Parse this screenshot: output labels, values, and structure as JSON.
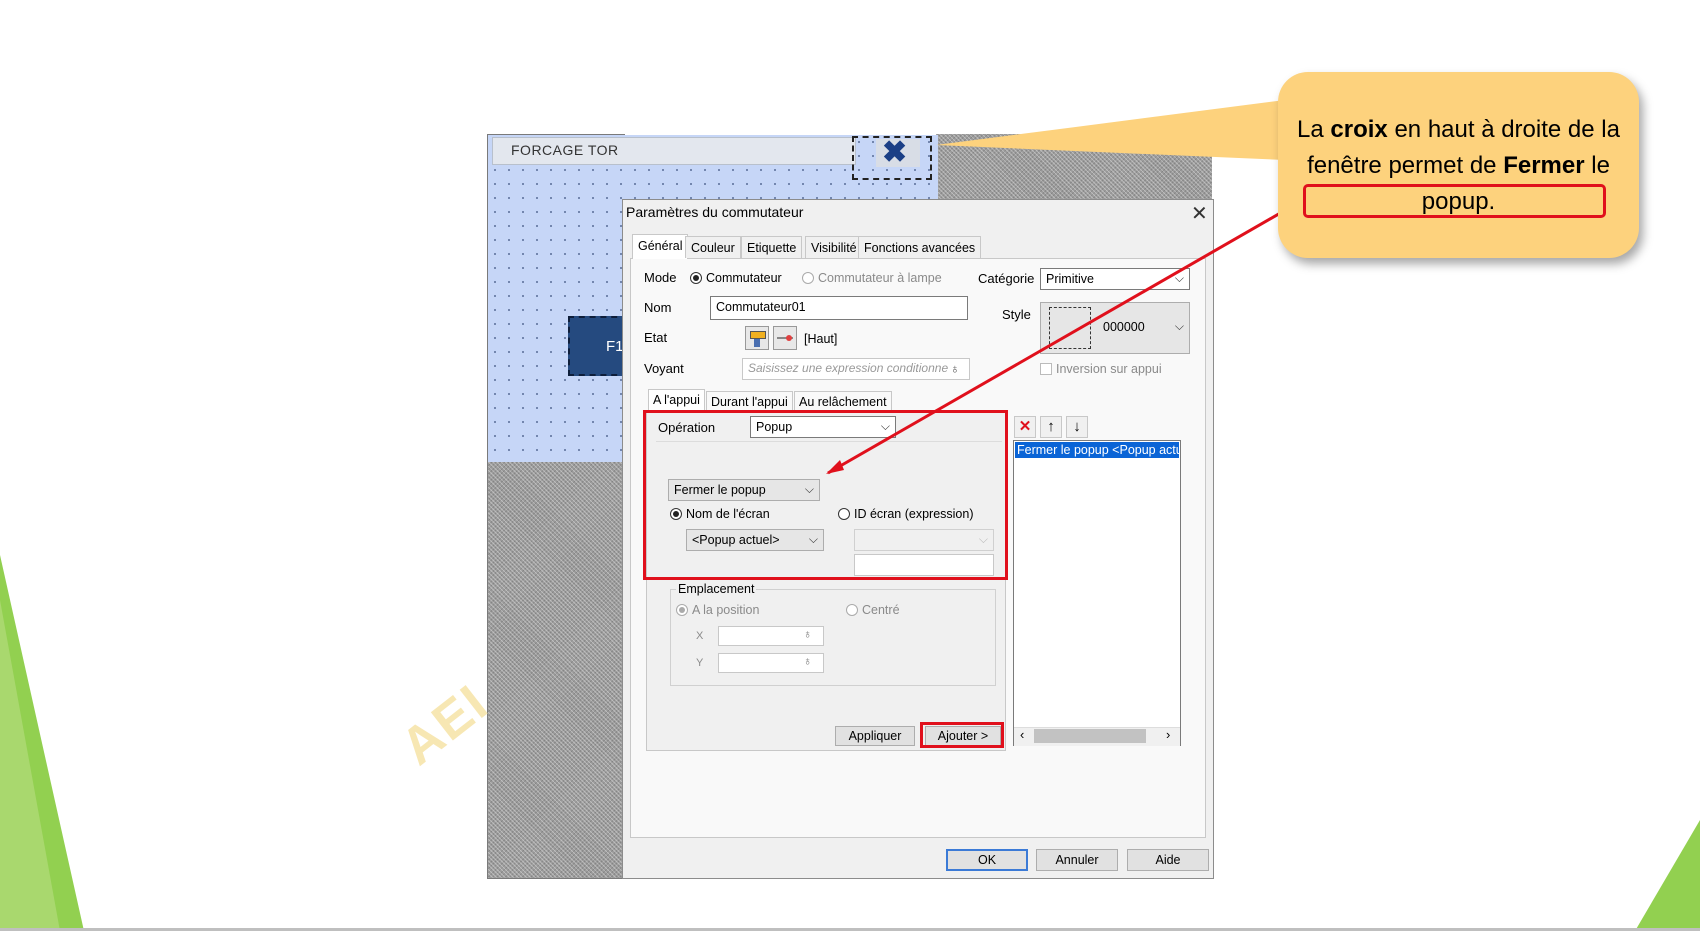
{
  "popup": {
    "title": "FORCAGE  TOR",
    "close_glyph": "✖",
    "button_label": "F1"
  },
  "watermark": "AEI",
  "dialog": {
    "title": "Paramètres du commutateur",
    "close_glyph": "✕",
    "tabs": [
      "Général",
      "Couleur",
      "Etiquette",
      "Visibilité",
      "Fonctions avancées"
    ],
    "mode_label": "Mode",
    "mode_option_1": "Commutateur",
    "mode_option_2": "Commutateur à lampe",
    "categorie_label": "Catégorie",
    "categorie_value": "Primitive",
    "nom_label": "Nom",
    "nom_value": "Commutateur01",
    "style_label": "Style",
    "style_value": "000000",
    "etat_label": "Etat",
    "etat_value": "[Haut]",
    "voyant_label": "Voyant",
    "voyant_placeholder": "Saisissez une expression conditionne",
    "inversion_label": "Inversion sur appui",
    "subtabs": [
      "A l'appui",
      "Durant l'appui",
      "Au relâchement"
    ],
    "operation_label": "Opération",
    "operation_value": "Popup",
    "action_value": "Fermer le popup",
    "nom_ecran_label": "Nom de l'écran",
    "id_ecran_label": "ID écran (expression)",
    "screen_value": "<Popup actuel>",
    "emplacement_label": "Emplacement",
    "a_la_position_label": "A la position",
    "centre_label": "Centré",
    "x_label": "X",
    "y_label": "Y",
    "list_item": "Fermer le popup <Popup actuel>",
    "appliquer_label": "Appliquer",
    "ajouter_label": "Ajouter >",
    "ok_label": "OK",
    "annuler_label": "Annuler",
    "aide_label": "Aide"
  },
  "callout": {
    "part1": "La ",
    "bold1": "croix",
    "part2": " en haut à droite de la fenêtre permet de ",
    "bold2": "Fermer",
    "part3": " le popup."
  },
  "colors": {
    "highlight_red": "#e0101c",
    "callout_fill": "#fdd27d",
    "accent_green": "#92d050"
  }
}
